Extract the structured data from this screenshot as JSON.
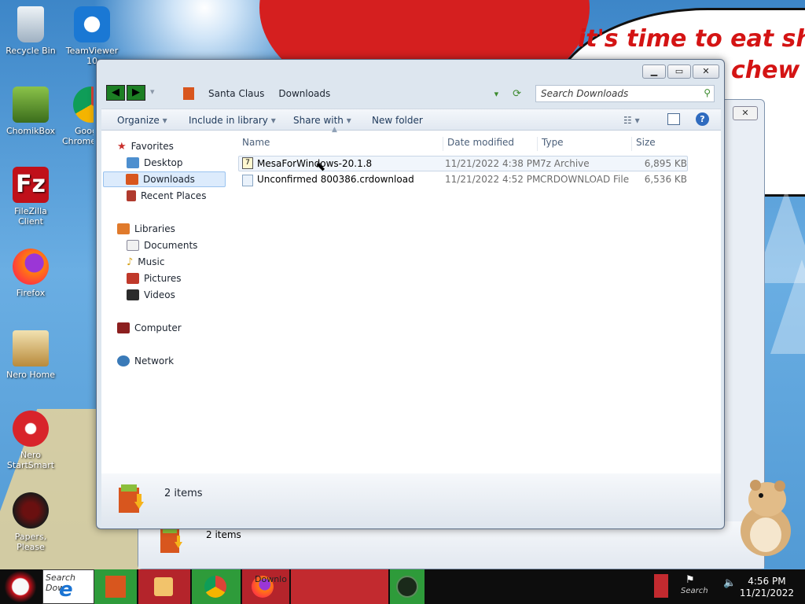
{
  "desktop": {
    "speech_lines": [
      "it's time to eat shit",
      "chew"
    ],
    "icons": [
      {
        "label": "Recycle Bin",
        "icon": "recycle-bin-icon"
      },
      {
        "label": "TeamViewer 10",
        "icon": "teamviewer-icon"
      },
      {
        "label": "ChomikBox",
        "icon": "chomikbox-icon"
      },
      {
        "label": "Google Chrome",
        "icon": "chrome-icon"
      },
      {
        "label": "FileZilla Client",
        "icon": "filezilla-icon"
      },
      {
        "label": "Firefox",
        "icon": "firefox-icon"
      },
      {
        "label": "Nero Home",
        "icon": "nero-home-icon"
      },
      {
        "label": "Nero StartSmart",
        "icon": "nero-startsmart-icon"
      },
      {
        "label": "Papers, Please",
        "icon": "papers-please-icon"
      }
    ]
  },
  "background_window": {
    "status": "2 items"
  },
  "window": {
    "controls": {
      "minimize": "▁",
      "maximize": "▭",
      "close": "✕"
    },
    "breadcrumbs": [
      "Santa Claus",
      "Downloads"
    ],
    "search_placeholder": "Search Downloads",
    "toolbar": {
      "organize": "Organize",
      "include_in_library": "Include in library",
      "share_with": "Share with",
      "new_folder": "New folder"
    },
    "nav": {
      "favorites": "Favorites",
      "favorites_items": [
        "Desktop",
        "Downloads",
        "Recent Places"
      ],
      "libraries": "Libraries",
      "libraries_items": [
        "Documents",
        "Music",
        "Pictures",
        "Videos"
      ],
      "computer": "Computer",
      "network": "Network"
    },
    "columns": [
      "Name",
      "Date modified",
      "Type",
      "Size"
    ],
    "files": [
      {
        "name": "MesaForWindows-20.1.8",
        "date": "11/21/2022 4:38 PM",
        "type": "7z Archive",
        "size": "6,895 KB"
      },
      {
        "name": "Unconfirmed 800386.crdownload",
        "date": "11/21/2022 4:52 PM",
        "type": "CRDOWNLOAD File",
        "size": "6,536 KB"
      }
    ],
    "status": "2 items"
  },
  "taskbar": {
    "search_text": "Search Dow",
    "downloads_button": "Downlo",
    "tray_search": "Search",
    "time": "4:56 PM",
    "date": "11/21/2022"
  }
}
